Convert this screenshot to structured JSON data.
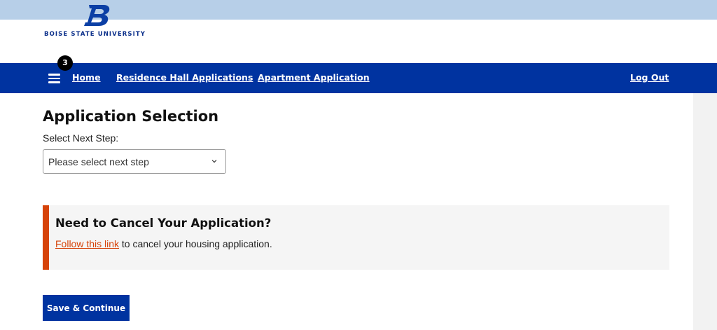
{
  "header": {
    "logo_text": "BOISE STATE UNIVERSITY",
    "logo_letter": "B",
    "strip_color": "#b7cfe8",
    "brand_color": "#0033a0"
  },
  "nav": {
    "menu_icon": "hamburger-icon",
    "badge_count": "3",
    "links": [
      {
        "label": "Home"
      },
      {
        "label": "Residence Hall Applications"
      },
      {
        "label": "Apartment Application"
      }
    ],
    "logout_label": "Log Out"
  },
  "main": {
    "title": "Application Selection",
    "select_label": "Select Next Step:",
    "select_value": "Please select next step",
    "select_icon": "chevron-down-icon"
  },
  "cancel_notice": {
    "heading": "Need to Cancel Your Application?",
    "link_text": "Follow this link",
    "text_after": " to cancel your housing application.",
    "accent_color": "#d64309"
  },
  "actions": {
    "save_label": "Save & Continue"
  }
}
